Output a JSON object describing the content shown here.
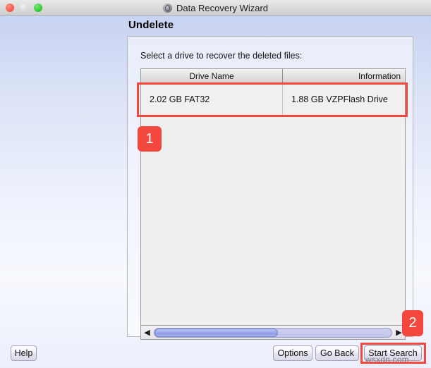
{
  "window": {
    "title": "Data Recovery Wizard",
    "title_icon": "app-globe-icon",
    "traffic_lights": {
      "close": "close-button",
      "minimize": "minimize-button",
      "maximize": "maximize-button"
    }
  },
  "page": {
    "heading": "Undelete",
    "instruction": "Select a drive to recover the deleted files:"
  },
  "table": {
    "columns": [
      "Drive Name",
      "Information"
    ],
    "rows": [
      {
        "drive_name": "2.02 GB FAT32",
        "information": "1.88 GB VZPFlash Drive"
      }
    ]
  },
  "scrollbar": {
    "left_arrow": "◀",
    "right_arrow": "▶",
    "thumb_percent": 52
  },
  "buttons": {
    "help": "Help",
    "options": "Options",
    "go_back": "Go Back",
    "start_search": "Start Search"
  },
  "annotations": {
    "badge_1": "1",
    "badge_2": "2",
    "highlight_color": "#f4483f"
  },
  "watermark": "wsxdn.com"
}
